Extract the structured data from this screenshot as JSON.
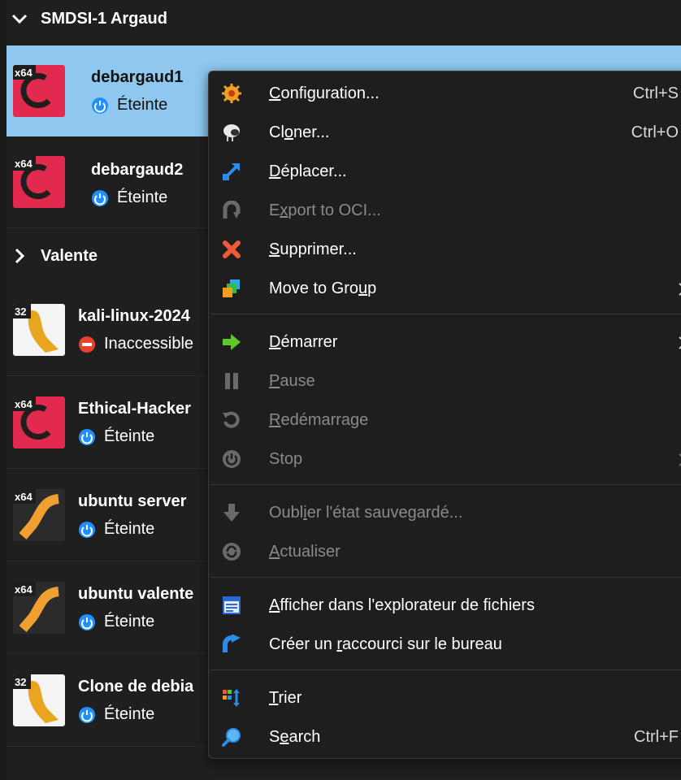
{
  "groups": {
    "smdsi": {
      "label": "SMDSI-1 Argaud",
      "expanded": true
    },
    "valente": {
      "label": "Valente",
      "expanded": false
    }
  },
  "vms": [
    {
      "name": "debargaud1",
      "status": "Éteinte",
      "arch": "x64",
      "os_icon": "debian-icon",
      "status_icon": "power-icon",
      "selected": true
    },
    {
      "name": "debargaud2",
      "status": "Éteinte",
      "arch": "x64",
      "os_icon": "debian-icon",
      "status_icon": "power-icon",
      "selected": false
    },
    {
      "name": "kali-linux-2024",
      "status": "Inaccessible",
      "arch": "32",
      "os_icon": "generic-linux-icon",
      "status_icon": "error-icon",
      "selected": false
    },
    {
      "name": "Ethical-Hacker",
      "status": "Éteinte",
      "arch": "x64",
      "os_icon": "debian-icon",
      "status_icon": "power-icon",
      "selected": false
    },
    {
      "name": "ubuntu server",
      "status": "Éteinte",
      "arch": "x64",
      "os_icon": "ubuntu-icon",
      "status_icon": "power-icon",
      "selected": false
    },
    {
      "name": "ubuntu valente",
      "status": "Éteinte",
      "arch": "x64",
      "os_icon": "ubuntu-icon",
      "status_icon": "power-icon",
      "selected": false
    },
    {
      "name": "Clone de debia",
      "status": "Éteinte",
      "arch": "32",
      "os_icon": "generic-linux-icon",
      "status_icon": "power-icon",
      "selected": false
    }
  ],
  "menu": {
    "configuration": {
      "pre": "",
      "u": "C",
      "post": "onfiguration...",
      "shortcut": "Ctrl+S"
    },
    "cloner": {
      "pre": "Cl",
      "u": "o",
      "post": "ner...",
      "shortcut": "Ctrl+O"
    },
    "deplacer": {
      "pre": "",
      "u": "D",
      "post": "éplacer..."
    },
    "export": {
      "pre": "E",
      "u": "x",
      "post": "port to OCI..."
    },
    "supprimer": {
      "pre": "",
      "u": "S",
      "post": "upprimer..."
    },
    "move_group": {
      "pre": "Move to Gro",
      "u": "u",
      "post": "p"
    },
    "demarrer": {
      "pre": "",
      "u": "D",
      "post": "émarrer"
    },
    "pause": {
      "pre": "",
      "u": "P",
      "post": "ause"
    },
    "redemarrage": {
      "pre": "",
      "u": "R",
      "post": "edémarrage"
    },
    "stop": {
      "label": "Stop"
    },
    "oublier": {
      "pre": "Oubl",
      "u": "i",
      "post": "er l'état sauvegardé..."
    },
    "actualiser": {
      "pre": "",
      "u": "A",
      "post": "ctualiser"
    },
    "afficher": {
      "pre": "",
      "u": "A",
      "post": "fficher dans l'explorateur de fichiers"
    },
    "creer": {
      "pre": "Créer un ",
      "u": "r",
      "post": "accourci sur le bureau"
    },
    "trier": {
      "pre": "",
      "u": "T",
      "post": "rier"
    },
    "search": {
      "pre": "S",
      "u": "e",
      "post": "arch",
      "shortcut": "Ctrl+F"
    }
  },
  "colors": {
    "selection": "#8ec8ef",
    "background": "#1f1f1f",
    "menu_bg": "#1e1e1e",
    "disabled_text": "#8a8a8a",
    "power_blue": "#1e90ff"
  }
}
